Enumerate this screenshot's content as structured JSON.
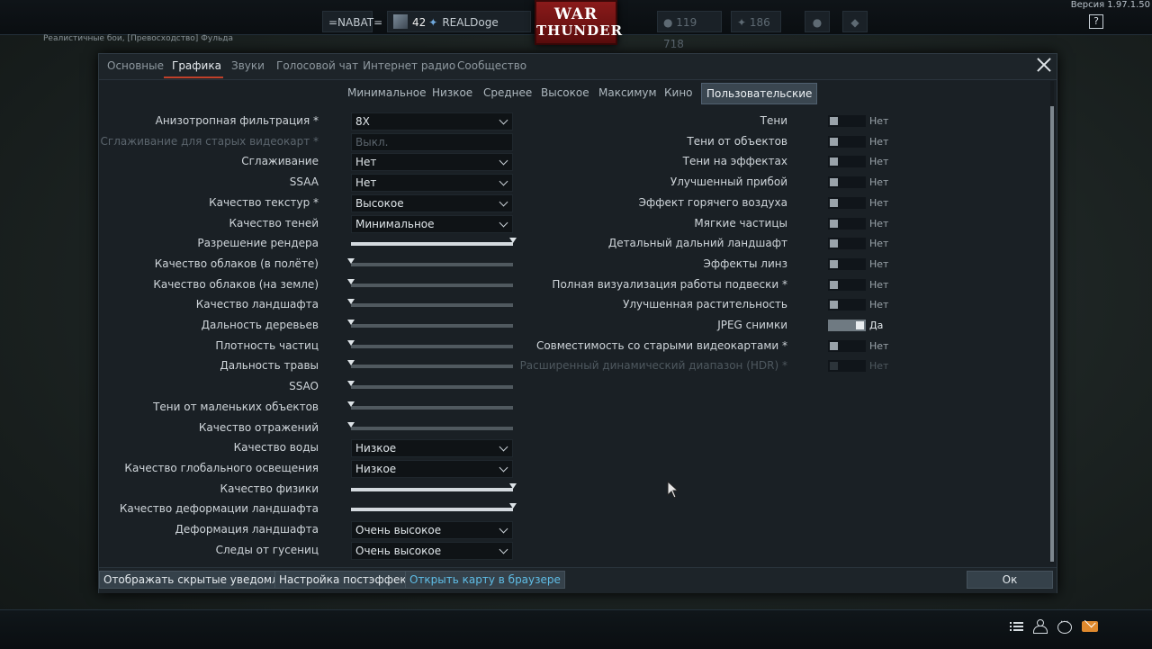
{
  "topbar": {
    "version": "Версия 1.97.1.50",
    "clan": "=NABAT=",
    "player_rank": "42",
    "player_name": "REALDoge",
    "logo_line1": "WAR",
    "logo_line2": "THUNDER",
    "silver_lions": "119 718",
    "research_points": "186",
    "help": "?"
  },
  "battle_mode": "Реалистичные бои, [Превосходство] Фульда",
  "tabs": [
    {
      "label": "Основные",
      "active": false
    },
    {
      "label": "Графика",
      "active": true
    },
    {
      "label": "Звуки",
      "active": false
    },
    {
      "label": "Голосовой чат",
      "active": false
    },
    {
      "label": "Интернет радио",
      "active": false
    },
    {
      "label": "Сообщество",
      "active": false
    }
  ],
  "presets": [
    {
      "label": "Минимальное",
      "active": false
    },
    {
      "label": "Низкое",
      "active": false
    },
    {
      "label": "Среднее",
      "active": false
    },
    {
      "label": "Высокое",
      "active": false
    },
    {
      "label": "Максимум",
      "active": false
    },
    {
      "label": "Кино",
      "active": false
    },
    {
      "label": "Пользовательские",
      "active": true
    }
  ],
  "left_settings": [
    {
      "label": "Анизотропная фильтрация *",
      "type": "dropdown",
      "value": "8X"
    },
    {
      "label": "Сглаживание для старых видеокарт *",
      "type": "dropdown",
      "value": "Выкл.",
      "disabled": true
    },
    {
      "label": "Сглаживание",
      "type": "dropdown",
      "value": "Нет"
    },
    {
      "label": "SSAA",
      "type": "dropdown",
      "value": "Нет"
    },
    {
      "label": "Качество текстур *",
      "type": "dropdown",
      "value": "Высокое"
    },
    {
      "label": "Качество теней",
      "type": "dropdown",
      "value": "Минимальное"
    },
    {
      "label": "Разрешение рендера",
      "type": "slider",
      "level": 1.0
    },
    {
      "label": "Качество облаков (в полёте)",
      "type": "slider",
      "level": 0.0
    },
    {
      "label": "Качество облаков (на земле)",
      "type": "slider",
      "level": 0.0
    },
    {
      "label": "Качество ландшафта",
      "type": "slider",
      "level": 0.0
    },
    {
      "label": "Дальность деревьев",
      "type": "slider",
      "level": 0.0
    },
    {
      "label": "Плотность частиц",
      "type": "slider",
      "level": 0.0
    },
    {
      "label": "Дальность травы",
      "type": "slider",
      "level": 0.0
    },
    {
      "label": "SSAO",
      "type": "slider",
      "level": 0.0
    },
    {
      "label": "Тени от маленьких объектов",
      "type": "slider",
      "level": 0.0
    },
    {
      "label": "Качество отражений",
      "type": "slider",
      "level": 0.0
    },
    {
      "label": "Качество воды",
      "type": "dropdown",
      "value": "Низкое"
    },
    {
      "label": "Качество глобального освещения",
      "type": "dropdown",
      "value": "Низкое"
    },
    {
      "label": "Качество физики",
      "type": "slider",
      "level": 1.0
    },
    {
      "label": "Качество деформации ландшафта",
      "type": "slider",
      "level": 1.0
    },
    {
      "label": "Деформация ландшафта",
      "type": "dropdown",
      "value": "Очень высокое"
    },
    {
      "label": "Следы от гусениц",
      "type": "dropdown",
      "value": "Очень высокое"
    }
  ],
  "right_settings": [
    {
      "label": "Тени",
      "on": false,
      "value": "Нет"
    },
    {
      "label": "Тени от объектов",
      "on": false,
      "value": "Нет"
    },
    {
      "label": "Тени на эффектах",
      "on": false,
      "value": "Нет"
    },
    {
      "label": "Улучшенный прибой",
      "on": false,
      "value": "Нет"
    },
    {
      "label": "Эффект горячего воздуха",
      "on": false,
      "value": "Нет"
    },
    {
      "label": "Мягкие частицы",
      "on": false,
      "value": "Нет"
    },
    {
      "label": "Детальный дальний ландшафт",
      "on": false,
      "value": "Нет"
    },
    {
      "label": "Эффекты линз",
      "on": false,
      "value": "Нет"
    },
    {
      "label": "Полная визуализация работы подвески *",
      "on": false,
      "value": "Нет"
    },
    {
      "label": "Улучшенная растительность",
      "on": false,
      "value": "Нет"
    },
    {
      "label": "JPEG снимки",
      "on": true,
      "value": "Да"
    },
    {
      "label": "Совместимость со старыми видеокартами *",
      "on": false,
      "value": "Нет"
    },
    {
      "label": "Расширенный динамический диапазон (HDR) *",
      "on": false,
      "value": "Нет",
      "disabled": true
    }
  ],
  "footer": {
    "show_hidden": "Отображать скрытые уведомления",
    "postfx": "Настройка постэффектов",
    "open_map": "Открыть карту в браузере",
    "ok": "Ок"
  },
  "colors": {
    "accent_tab": "#c0402a",
    "link": "#5fbde6",
    "mail": "#e08a2e"
  },
  "icons": [
    "help-icon",
    "close-icon",
    "list-icon",
    "contacts-icon",
    "chat-icon",
    "mail-icon",
    "mouse-cursor-icon"
  ]
}
